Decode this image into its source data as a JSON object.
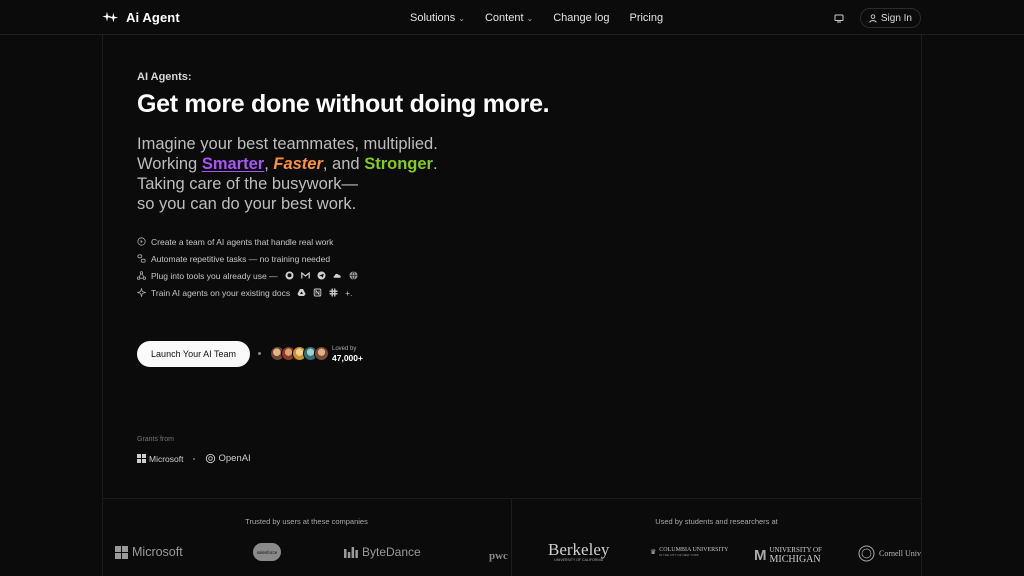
{
  "nav": {
    "brand": "Ai Agent",
    "links": [
      "Solutions",
      "Content",
      "Change log",
      "Pricing"
    ],
    "signin": "Sign In"
  },
  "hero": {
    "eyebrow": "AI Agents:",
    "headline": "Get more done without doing more.",
    "sub_line1": "Imagine your best teammates, multiplied.",
    "sub_working": "Working ",
    "smarter": "Smarter",
    "comma1": ", ",
    "faster": "Faster",
    "and": ", and ",
    "stronger": "Stronger",
    "period": ".",
    "sub_line3": "Taking care of the busywork—",
    "sub_line4": "so you can do your best work."
  },
  "features": [
    {
      "text": "Create a team of AI agents that handle real work",
      "icon": "circle-play-icon"
    },
    {
      "text": "Automate repetitive tasks — no training needed",
      "icon": "link-icon"
    },
    {
      "text": "Plug into tools you already use —",
      "icon": "network-icon",
      "tools": [
        "github-icon",
        "gmail-icon",
        "telegram-icon",
        "cloud-icon",
        "globe-icon"
      ]
    },
    {
      "text": "Train AI agents on your existing docs",
      "icon": "sparkle-icon",
      "tools": [
        "drive-icon",
        "notion-icon",
        "slack-icon"
      ],
      "suffix": "+."
    }
  ],
  "cta": {
    "label": "Launch Your AI Team",
    "loved_by": "Loved by",
    "count": "47,000+"
  },
  "grants": {
    "label": "Grants from",
    "microsoft": "Microsoft",
    "openai": "OpenAI"
  },
  "social": {
    "trusted": "Trusted by users at these companies",
    "used": "Used by students and researchers at",
    "companies": [
      "Microsoft",
      "salesforce",
      "ByteDance",
      "pwc"
    ],
    "universities": [
      "Berkeley",
      "UNIVERSITY OF CALIFORNIA",
      "COLUMBIA UNIVERSITY",
      "IN THE CITY OF NEW YORK",
      "UNIVERSITY OF",
      "MICHIGAN",
      "Cornell University"
    ]
  },
  "colors": {
    "smarter": "#a855f7",
    "faster": "#fb923c",
    "stronger": "#84cc16",
    "avatars": [
      "#c98a5b",
      "#d9a36b",
      "#e0c07a",
      "#6aa6b8",
      "#b57a55"
    ]
  }
}
